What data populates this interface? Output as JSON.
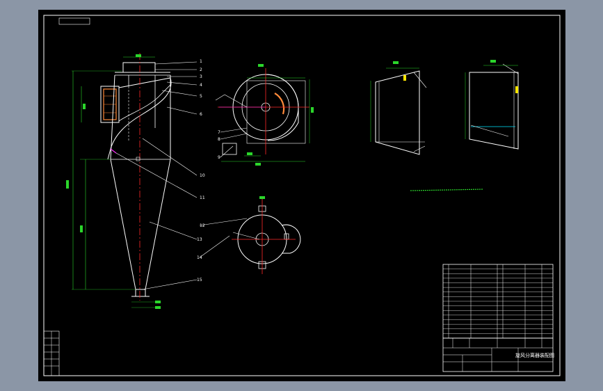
{
  "title_block": {
    "product_name": "旋风分离器装配图"
  },
  "parts": [
    {
      "no": "1"
    },
    {
      "no": "2"
    },
    {
      "no": "3"
    },
    {
      "no": "4"
    },
    {
      "no": "5"
    },
    {
      "no": "6"
    },
    {
      "no": "7"
    },
    {
      "no": "8"
    },
    {
      "no": "9"
    },
    {
      "no": "10"
    },
    {
      "no": "11"
    },
    {
      "no": "12"
    },
    {
      "no": "13"
    },
    {
      "no": "14"
    },
    {
      "no": "15"
    }
  ],
  "colors": {
    "background": "#000000",
    "frame": "#ffffff",
    "geometry": "#ffffff",
    "dimension": "#2bd62b",
    "centerline": "#ff2a2a",
    "hidden": "#ffe600",
    "accent": "#00e5ff",
    "magenta": "#ff33ff"
  }
}
